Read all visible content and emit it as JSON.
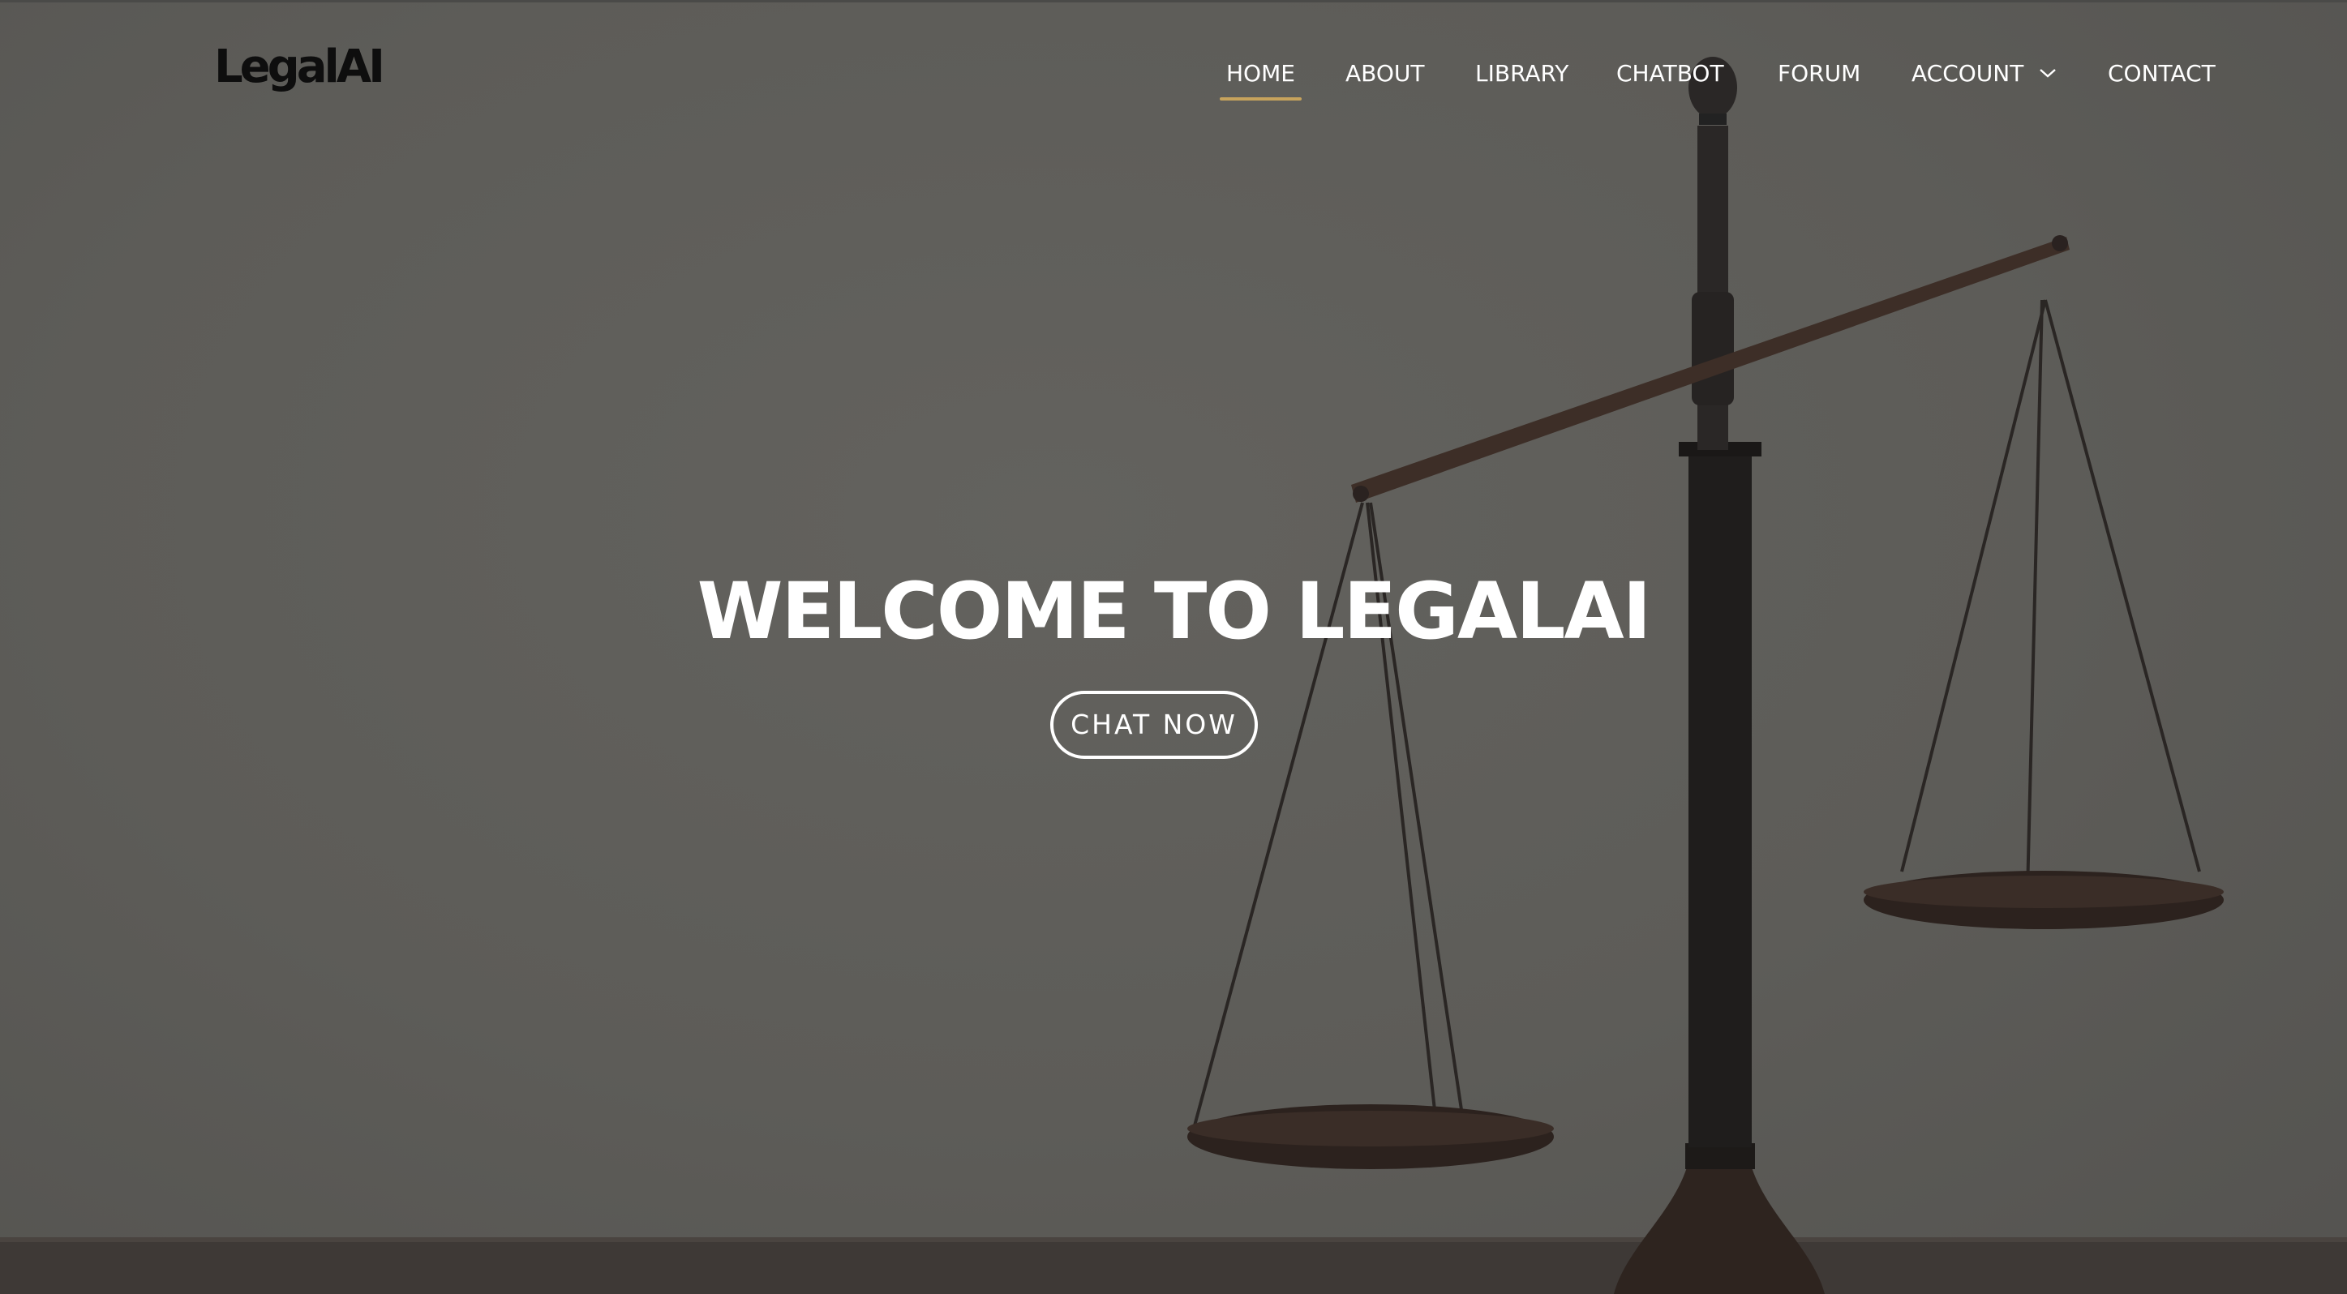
{
  "brand": {
    "logo_text": "LegalAI"
  },
  "nav": {
    "items": [
      {
        "label": "HOME",
        "active": true
      },
      {
        "label": "ABOUT"
      },
      {
        "label": "LIBRARY"
      },
      {
        "label": "CHATBOT"
      },
      {
        "label": "FORUM"
      },
      {
        "label": "ACCOUNT",
        "dropdown": true,
        "icon": "chevron-down-icon"
      },
      {
        "label": "CONTACT"
      }
    ]
  },
  "hero": {
    "title": "WELCOME TO LEGALAI",
    "cta_label": "CHAT NOW",
    "image": "scales-of-justice"
  },
  "colors": {
    "overlay": "#5c5b58",
    "nav_text": "#ffffff",
    "active_underline": "#c7a35c",
    "logo": "#0e0e0e"
  }
}
